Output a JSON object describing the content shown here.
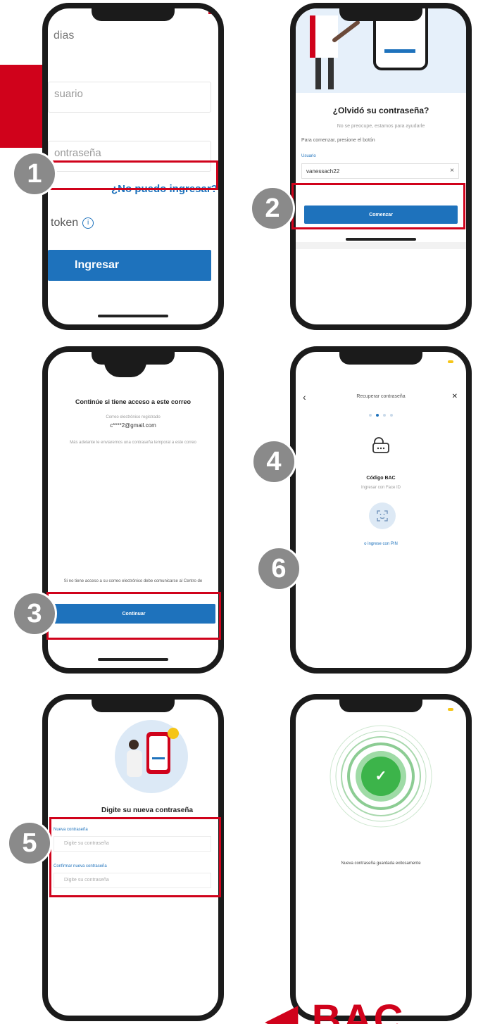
{
  "steps": {
    "s1": "1",
    "s2": "2",
    "s3": "3",
    "s4": "4",
    "s5": "5",
    "s6": "6"
  },
  "screen1": {
    "greeting": "dias",
    "user_placeholder": "suario",
    "password_placeholder": "ontraseña",
    "cant_login_link": "¿No puedo ingresar?",
    "token_label": "token",
    "info_glyph": "i",
    "login_button": "Ingresar"
  },
  "screen2": {
    "title": "¿Olvidó su contraseña?",
    "subtitle": "No se preocupe, estamos para ayudarle",
    "instruction": "Para comenzar, presione el botón",
    "user_label": "Usuario",
    "user_value": "vanessach22",
    "clear_glyph": "×",
    "start_button": "Comenzar"
  },
  "screen3": {
    "title": "Continúe si tiene acceso a este correo",
    "email_label": "Correo electrónico registrado",
    "email_value": "c****2@gmail.com",
    "description": "Más adelante le enviaremos una contraseña temporal a este correo",
    "no_access": "Si no tiene acceso a su correo electrónico debe comunicarse al Centro de",
    "continue_button": "Continuar"
  },
  "screen4": {
    "back_glyph": "‹",
    "close_glyph": "✕",
    "title": "Recuperar contraseña",
    "method_title": "Código BAC",
    "method_subtitle": "Ingresar con Face ID",
    "pin_link": "o ingrese con PIN"
  },
  "screen5": {
    "title": "Digite su nueva contraseña",
    "new_label": "Nueva contraseña",
    "new_placeholder": "Digite su contraseña",
    "confirm_label": "Confirmar nueva contraseña",
    "confirm_placeholder": "Digite su contraseña"
  },
  "screen6": {
    "check_glyph": "✓",
    "message": "Nueva contraseña guardada exitosamente"
  },
  "brand": {
    "logo_text": "◀ BAC",
    "colors": {
      "red": "#d0021b",
      "blue": "#1e72bc",
      "green": "#3cb44a",
      "badge": "#8a8a8a"
    }
  }
}
